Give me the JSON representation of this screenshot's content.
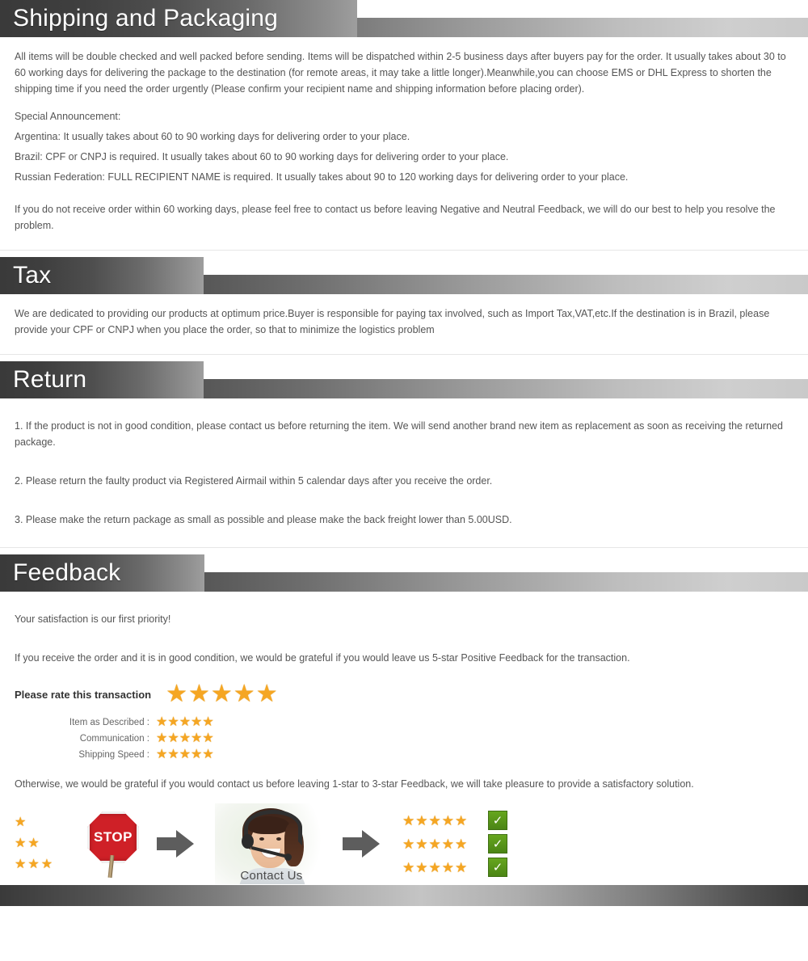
{
  "sections": {
    "shipping": {
      "title": "Shipping and Packaging",
      "p1": "All items will be double checked and well packed before sending. Items will be dispatched within 2-5 business days after buyers pay for the order. It usually takes about 30 to 60 working days for delivering the package to the destination (for remote areas, it may take a little longer).Meanwhile,you can choose EMS or DHL Express to shorten the shipping time if you need the order urgently (Please confirm your recipient name and shipping information before placing order).",
      "announcement_label": "Special Announcement:",
      "announcements": [
        "Argentina: It usually takes about 60 to 90 working days for delivering order to your place.",
        "Brazil: CPF or CNPJ is required. It usually takes about 60 to 90 working days for delivering order to your place.",
        "Russian Federation: FULL RECIPIENT NAME is required. It usually takes about 90 to 120 working days for delivering order to your place."
      ],
      "p_closing": "If you do not receive order within 60 working days, please feel free to contact us before leaving Negative and Neutral Feedback, we will do our best to help you resolve the problem."
    },
    "tax": {
      "title": "Tax",
      "p1": "We are dedicated to providing our products at optimum price.Buyer is responsible for paying tax involved, such as Import Tax,VAT,etc.If the destination is in Brazil, please provide your CPF or CNPJ when you place the order, so that to minimize the logistics problem"
    },
    "return": {
      "title": "Return",
      "items": [
        "1. If the product is not in good condition, please contact us before returning the item. We will send another brand new item as replacement as soon as receiving the returned package.",
        "2. Please return the faulty product via Registered Airmail within 5 calendar days after you receive the order.",
        "3. Please make the return package as small as possible and please make the back freight lower than 5.00USD."
      ]
    },
    "feedback": {
      "title": "Feedback",
      "p1": "Your satisfaction is our first priority!",
      "p2": "If you receive the order and it is in good condition, we would be grateful if you would leave us 5-star Positive Feedback for the transaction.",
      "rate_label": "Please rate this transaction",
      "rate_stars": 5,
      "sub_ratings": [
        {
          "label": "Item as Described :",
          "stars": 5
        },
        {
          "label": "Communication :",
          "stars": 5
        },
        {
          "label": "Shipping Speed :",
          "stars": 5
        }
      ],
      "p3": "Otherwise, we would be grateful if you would contact us before leaving 1-star to 3-star Feedback, we will take pleasure to provide a satisfactory solution.",
      "illustration": {
        "bad_star_rows": [
          1,
          2,
          3
        ],
        "stop_label": "STOP",
        "agent_caption": "Contact Us",
        "good_star_rows": [
          5,
          5,
          5
        ],
        "check_glyph": "✓"
      }
    }
  },
  "glyphs": {
    "star": "★"
  },
  "colors": {
    "star": "#f5a623",
    "check_green": "#4b8515",
    "stop_red": "#cf2027",
    "header_dark": "#3a3a3a",
    "header_light": "#cfcfcf",
    "text": "#555555"
  }
}
